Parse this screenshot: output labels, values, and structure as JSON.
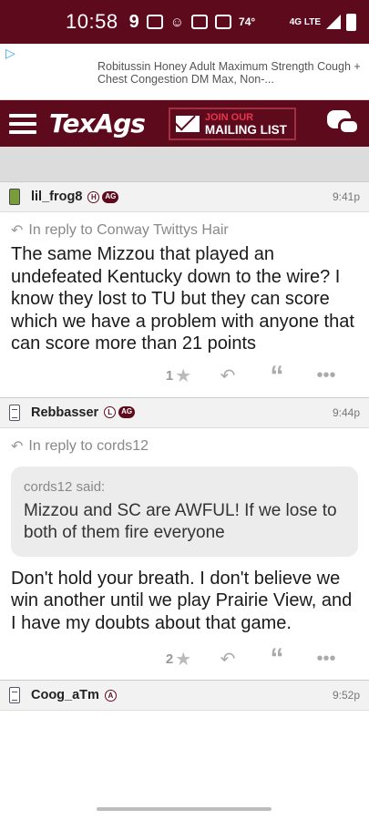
{
  "status_bar": {
    "time": "10:58",
    "temperature": "74°",
    "network": "4G LTE"
  },
  "ad": {
    "text": "Robitussin Honey Adult Maximum Strength Cough + Chest Congestion DM Max, Non-..."
  },
  "nav": {
    "logo": "TexAgs",
    "mailing_line1": "JOIN OUR",
    "mailing_line2": "MAILING LIST"
  },
  "posts": [
    {
      "username": "lil_frog8",
      "badges": [
        "H",
        "AG"
      ],
      "time": "9:41p",
      "reply_to": "In reply to Conway Twittys Hair",
      "body": "The same Mizzou that played an undefeated Kentucky down to the wire? I know they lost to TU but they can score which we have a problem with anyone that can score more than 21 points",
      "rating": "1"
    },
    {
      "username": "Rebbasser",
      "badges": [
        "L",
        "AG"
      ],
      "time": "9:44p",
      "reply_to": "In reply to cords12",
      "quote_said": "cords12 said:",
      "quote_text": "Mizzou and SC are AWFUL! If we lose to both of them fire everyone",
      "body": "Don't hold your breath. I don't believe we win another until we play Prairie View, and I have my doubts about that game.",
      "rating": "2"
    },
    {
      "username": "Coog_aTm",
      "badges": [
        "A"
      ],
      "time": "9:52p"
    }
  ]
}
